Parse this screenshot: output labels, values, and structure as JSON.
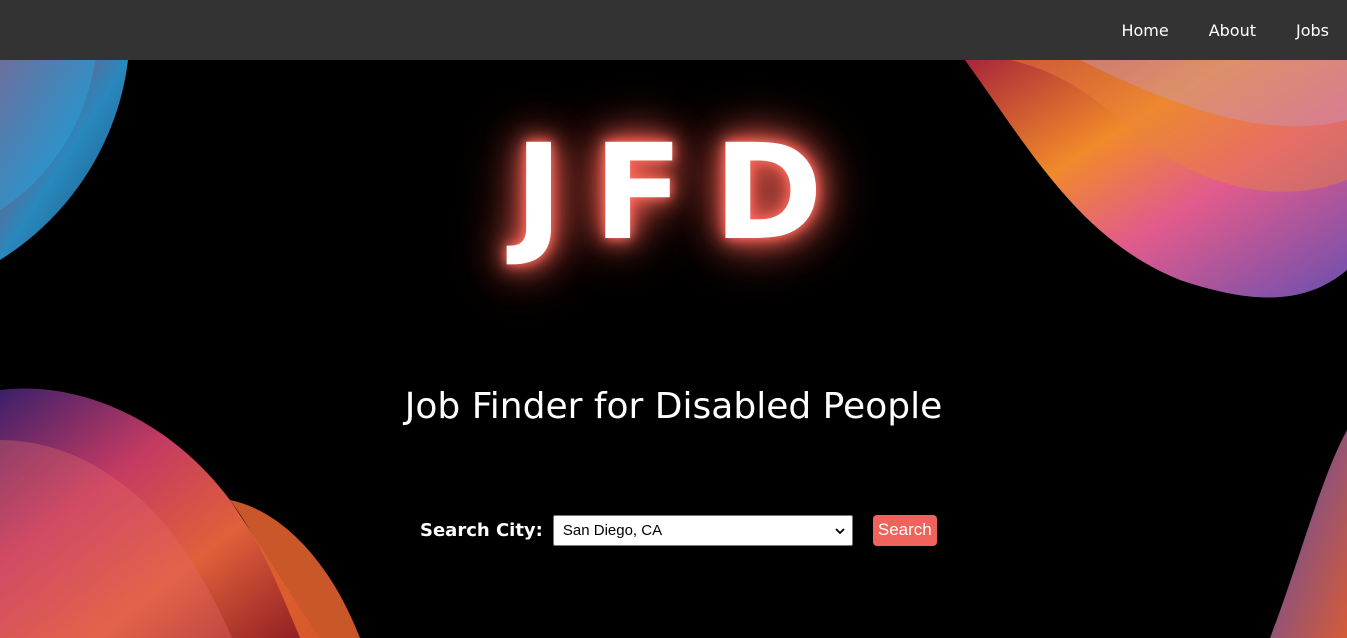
{
  "nav": {
    "links": [
      {
        "label": "Home"
      },
      {
        "label": "About"
      },
      {
        "label": "Jobs"
      }
    ]
  },
  "hero": {
    "logo": "JFD",
    "subtitle": "Job Finder for Disabled People"
  },
  "search": {
    "label": "Search City:",
    "selected_city": "San Diego, CA",
    "button_label": "Search"
  },
  "colors": {
    "navbar": "#333333",
    "background": "#000000",
    "accent": "#f0625c",
    "logo_glow": "#ff6b5e"
  },
  "icons": [
    "chevron-down-icon"
  ]
}
